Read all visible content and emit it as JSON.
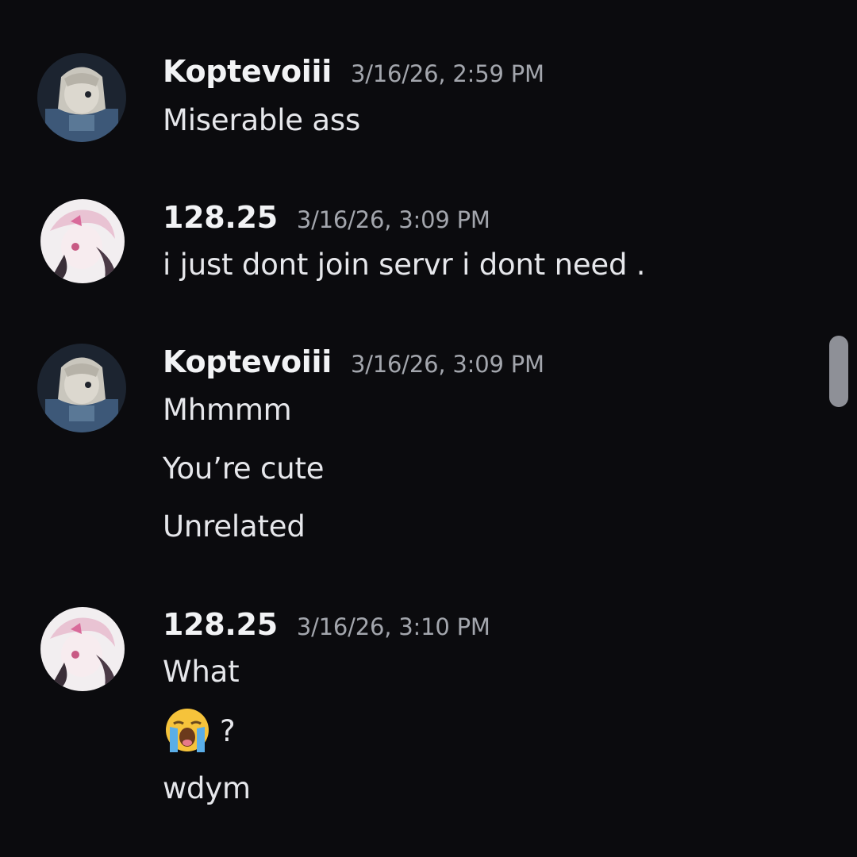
{
  "messages": [
    {
      "username": "Koptevoiii",
      "timestamp": "3/16/26, 2:59 PM",
      "lines": [
        "Miserable ass"
      ]
    },
    {
      "username": "128.25",
      "timestamp": "3/16/26, 3:09 PM",
      "lines": [
        "i just dont join servr i dont need ."
      ]
    },
    {
      "username": "Koptevoiii",
      "timestamp": "3/16/26, 3:09 PM",
      "lines": [
        "Mhmmm",
        "You’re cute",
        "Unrelated"
      ]
    },
    {
      "username": "128.25",
      "timestamp": "3/16/26, 3:10 PM",
      "lines": [
        "What",
        "?",
        "wdym"
      ],
      "emoji": "loudly-crying-face-icon"
    }
  ],
  "colors": {
    "background": "#0b0b0e",
    "username": "#f2f3f5",
    "timestamp": "#a3a6ad",
    "message": "#e6e7eb",
    "scrollbar": "#8e9097"
  }
}
